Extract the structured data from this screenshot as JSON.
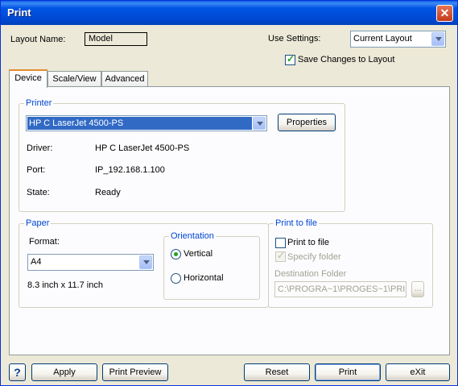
{
  "window": {
    "title": "Print",
    "close_glyph": "✕"
  },
  "header": {
    "layout_name_label": "Layout Name:",
    "layout_name_value": "Model",
    "use_settings_label": "Use Settings:",
    "use_settings_value": "Current Layout",
    "save_changes_label": "Save Changes to Layout",
    "save_changes_checked": true
  },
  "tabs": [
    {
      "label": "Device",
      "active": true
    },
    {
      "label": "Scale/View",
      "active": false
    },
    {
      "label": "Advanced",
      "active": false
    }
  ],
  "printer": {
    "legend": "Printer",
    "selected": "HP C LaserJet 4500-PS",
    "properties_label": "Properties",
    "driver_label": "Driver:",
    "driver_value": "HP C LaserJet 4500-PS",
    "port_label": "Port:",
    "port_value": "IP_192.168.1.100",
    "state_label": "State:",
    "state_value": "Ready"
  },
  "paper": {
    "legend": "Paper",
    "format_label": "Format:",
    "format_value": "A4",
    "size_text": "8.3 inch x 11.7 inch"
  },
  "orientation": {
    "legend": "Orientation",
    "vertical_label": "Vertical",
    "horizontal_label": "Horizontal",
    "selected": "Vertical"
  },
  "print_to_file": {
    "legend": "Print to file",
    "print_to_file_label": "Print to file",
    "print_to_file_checked": false,
    "specify_folder_label": "Specify folder",
    "specify_folder_checked": true,
    "destination_label": "Destination Folder",
    "destination_value": "C:\\PROGRA~1\\PROGES~1\\PRI",
    "browse_label": "..."
  },
  "footer": {
    "help_label": "?",
    "apply_label": "Apply",
    "preview_label": "Print Preview",
    "reset_label": "Reset",
    "print_label": "Print",
    "exit_label": "eXit"
  }
}
